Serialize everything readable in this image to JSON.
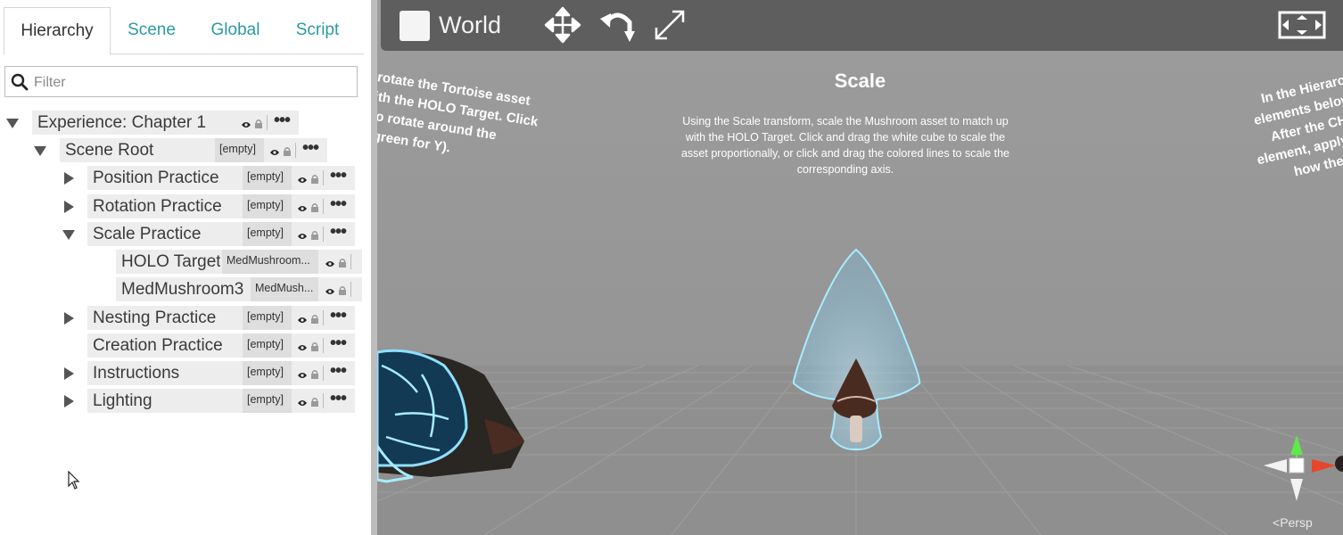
{
  "tabs": [
    "Hierarchy",
    "Scene",
    "Global",
    "Script"
  ],
  "filter": {
    "placeholder": "Filter"
  },
  "tree": [
    {
      "label": "Experience: Chapter 1",
      "tag": ""
    },
    {
      "label": "Scene Root",
      "tag": "[empty]"
    },
    {
      "label": "Position Practice",
      "tag": "[empty]"
    },
    {
      "label": "Rotation Practice",
      "tag": "[empty]"
    },
    {
      "label": "Scale Practice",
      "tag": "[empty]"
    },
    {
      "label": "HOLO Target",
      "tag": "MedMushroom..."
    },
    {
      "label": "MedMushroom3",
      "tag": "MedMush..."
    },
    {
      "label": "Nesting Practice",
      "tag": "[empty]"
    },
    {
      "label": "Creation Practice",
      "tag": "[empty]"
    },
    {
      "label": "Instructions",
      "tag": "[empty]"
    },
    {
      "label": "Lighting",
      "tag": "[empty]"
    }
  ],
  "menu_glyph": "•••",
  "toolbar": {
    "space_label": "World"
  },
  "scene": {
    "title": "Scale",
    "body": "Using the Scale transform, scale the Mushroom asset to match up with the HOLO Target. Click and drag the white cube to scale the asset proportionally, or click and drag the colored lines to scale the corresponding axis.",
    "left_text": "rotate the Tortoise asset\nith the HOLO Target. Click\nto rotate around the\n(green for Y).",
    "right_text": "In the Hierarchy w\nelements below and\nAfter the CHILD el\nelement, apply a tran\nhow the transfo",
    "persp_label": "Persp"
  },
  "icons": {
    "search": "search-icon",
    "caret_expanded": "caret-down-icon",
    "caret_collapsed": "caret-right-icon",
    "visibility": "eye-icon",
    "lock": "lock-icon",
    "move": "move-tool-icon",
    "rotate": "rotate-tool-icon",
    "scale": "scale-tool-icon",
    "fullscreen": "fullscreen-icon",
    "gizmo": "orientation-gizmo-icon",
    "cursor": "mouse-cursor-icon"
  },
  "colors": {
    "accent_tab": "#2a9aa4",
    "toolbar_bg": "#5e5e5e",
    "viewport_bg": "#999999",
    "hologram": "#7fd6ff"
  }
}
